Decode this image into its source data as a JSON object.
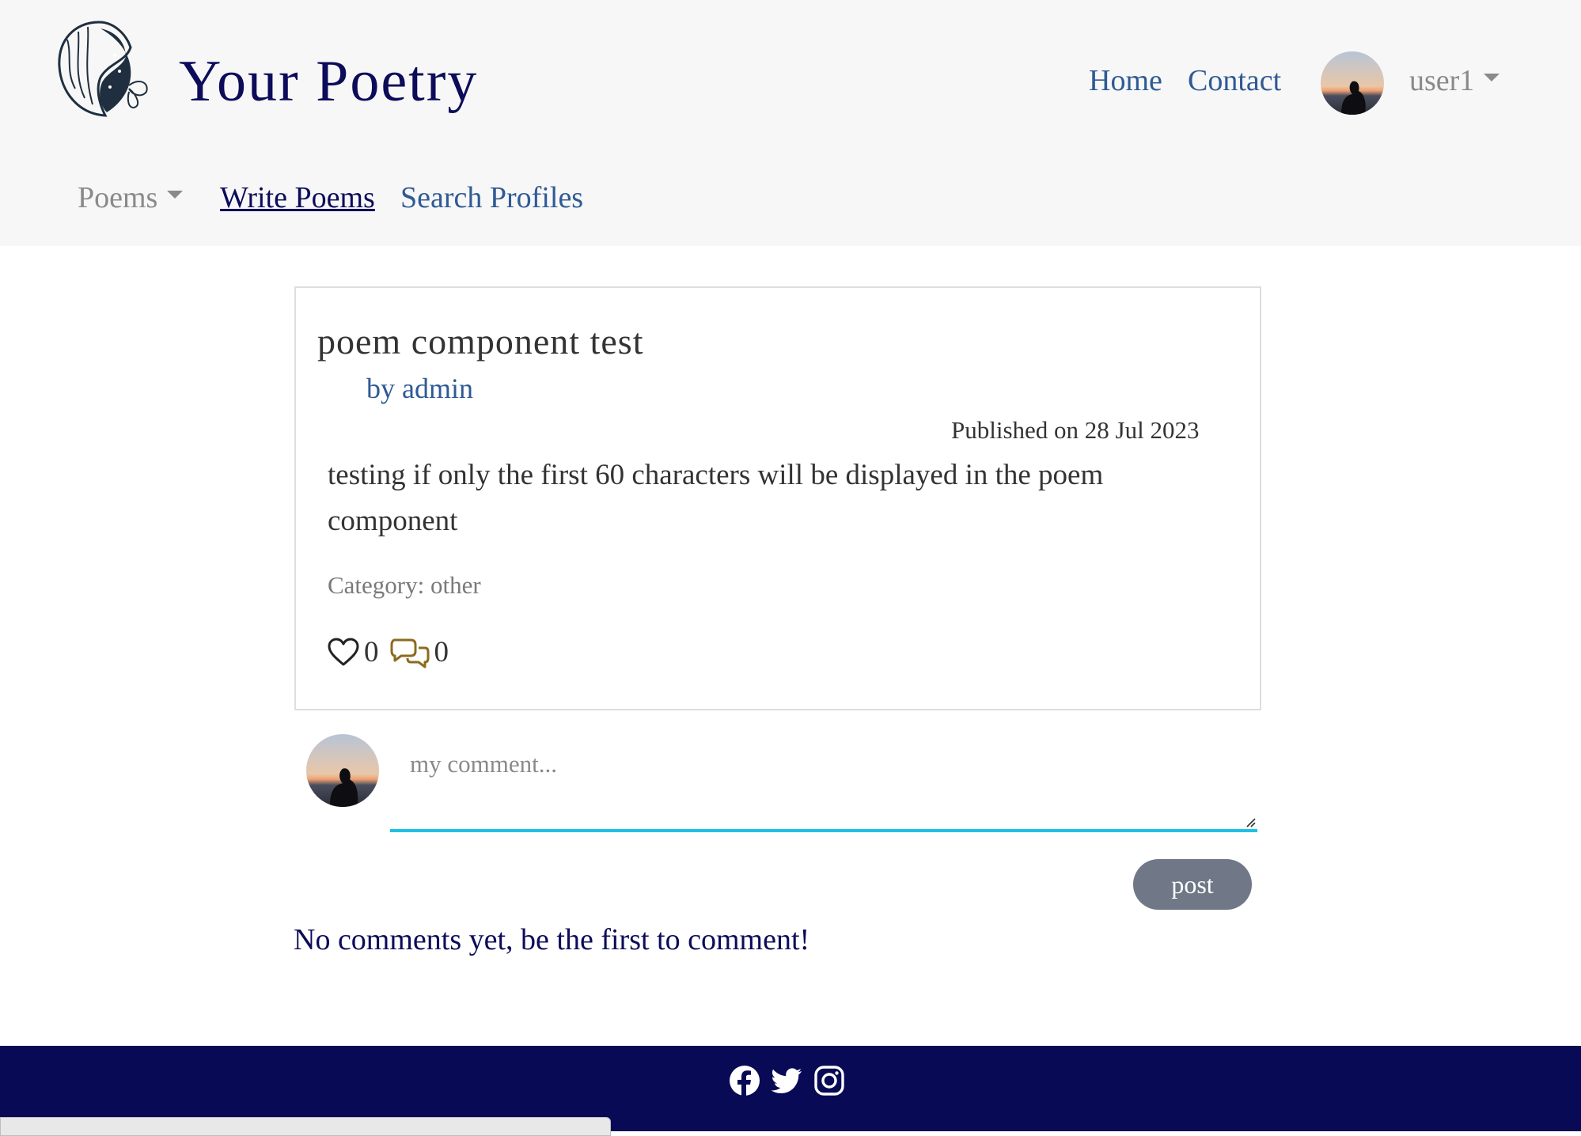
{
  "header": {
    "brand": "Your Poetry",
    "nav": {
      "home": "Home",
      "contact": "Contact"
    },
    "user": {
      "name": "user1"
    },
    "subnav": {
      "poems": "Poems",
      "write": "Write Poems",
      "search": "Search Profiles"
    }
  },
  "poem": {
    "title": "poem component test",
    "author": "by admin",
    "published": "Published on 28 Jul 2023",
    "body": "testing if only the first 60 characters will be displayed in the poem component",
    "category": "Category: other",
    "likes": "0",
    "comments": "0"
  },
  "comment_form": {
    "placeholder": "my comment...",
    "post_label": "post"
  },
  "comments": {
    "empty_message": "No comments yet, be the first to comment!"
  },
  "footer": {
    "social_icons": [
      "facebook-icon",
      "twitter-icon",
      "instagram-icon"
    ]
  },
  "status_bar": {
    "text": ""
  },
  "colors": {
    "brand_navy": "#0c0c5a",
    "link_blue": "#2f5a94",
    "footer_bg": "#080a55",
    "input_underline": "#1fc0e6",
    "post_button": "#707888",
    "comment_icon": "#8b6b1f"
  }
}
